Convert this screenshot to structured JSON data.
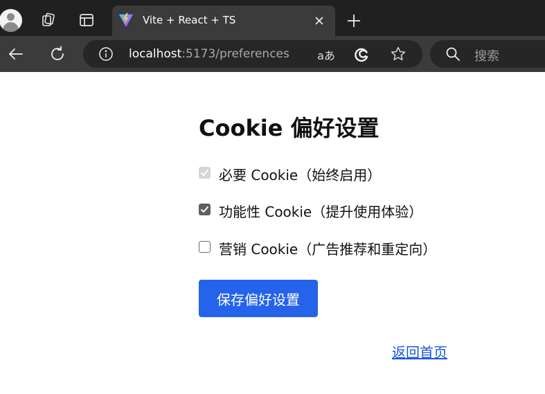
{
  "browser": {
    "tab": {
      "title": "Vite + React + TS",
      "favicon": "vite-logo-icon",
      "close": "close-icon"
    },
    "address_bar": {
      "host": "localhost",
      "path": ":5173/preferences",
      "read_aloud_label": "aあ"
    },
    "search_box": {
      "placeholder": "搜索"
    },
    "colors": {
      "tabstrip_bg": "#202020",
      "toolbar_bg": "#3b3b3b",
      "omnibox_bg": "#262626"
    }
  },
  "page": {
    "title": "Cookie 偏好设置",
    "options": [
      {
        "label": "必要 Cookie（始终启用）",
        "checked": true,
        "disabled": true
      },
      {
        "label": "功能性 Cookie（提升使用体验）",
        "checked": true,
        "disabled": false
      },
      {
        "label": "营销 Cookie（广告推荐和重定向）",
        "checked": false,
        "disabled": false
      }
    ],
    "save_button": "保存偏好设置",
    "back_link": "返回首页",
    "colors": {
      "primary_button": "#2563eb",
      "link": "#1a56db"
    }
  }
}
